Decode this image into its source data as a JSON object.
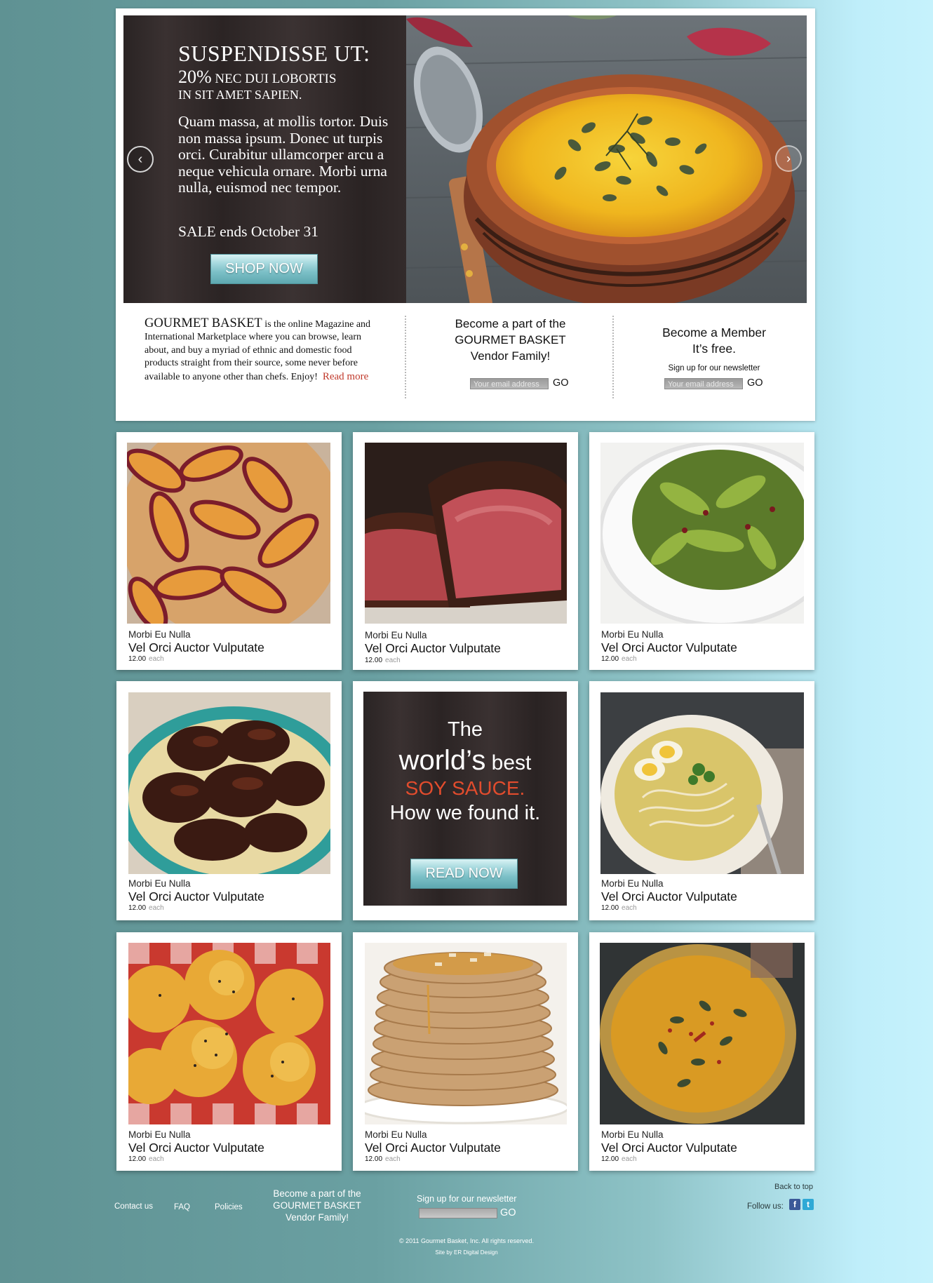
{
  "hero": {
    "title": "SUSPENDISSE UT:",
    "sub_big": "20%",
    "sub_rest": " NEC DUI LOBORTIS",
    "sub2": "IN SIT AMET SAPIEN.",
    "body": "Quam massa, at mollis tortor. Duis non massa ipsum. Donec ut turpis orci. Curabitur ullamcorper arcu a neque vehicula ornare. Morbi urna nulla, euismod nec tempor.",
    "sale": "SALE ends October 31",
    "button": "SHOP NOW",
    "arrow_left": "‹",
    "arrow_right": "›"
  },
  "info": {
    "brand": "GOURMET BASKET",
    "text": " is the online Magazine and International Marketplace where you can browse, learn about, and buy a myriad of ethnic and domestic food products straight from their source, some never before available to anyone other than chefs.  Enjoy!",
    "read_more": "Read more"
  },
  "vendor": {
    "line1": "Become a part of the",
    "line2": "GOURMET BASKET",
    "line3": "Vendor Family!",
    "placeholder": "Your email address",
    "go": "GO"
  },
  "member": {
    "line1": "Become a Member",
    "line2": "It’s free.",
    "sub": "Sign up for our newsletter",
    "placeholder": "Your email address",
    "go": "GO"
  },
  "products": [
    {
      "category": "Morbi Eu Nulla",
      "name": "Vel Orci Auctor Vulputate",
      "price": "12.00",
      "unit": "each",
      "image": "peach-tart"
    },
    {
      "category": "Morbi Eu Nulla",
      "name": "Vel Orci Auctor Vulputate",
      "price": "12.00",
      "unit": "each",
      "image": "steak"
    },
    {
      "category": "Morbi Eu Nulla",
      "name": "Vel Orci Auctor Vulputate",
      "price": "12.00",
      "unit": "each",
      "image": "green-salad"
    },
    {
      "category": "Morbi Eu Nulla",
      "name": "Vel Orci Auctor Vulputate",
      "price": "12.00",
      "unit": "each",
      "image": "glazed-chicken"
    },
    {
      "category": "Morbi Eu Nulla",
      "name": "Vel Orci Auctor Vulputate",
      "price": "12.00",
      "unit": "each",
      "image": "noodle-soup"
    },
    {
      "category": "Morbi Eu Nulla",
      "name": "Vel Orci Auctor Vulputate",
      "price": "12.00",
      "unit": "each",
      "image": "poppyseed-muffins"
    },
    {
      "category": "Morbi Eu Nulla",
      "name": "Vel Orci Auctor Vulputate",
      "price": "12.00",
      "unit": "each",
      "image": "pancakes"
    },
    {
      "category": "Morbi Eu Nulla",
      "name": "Vel Orci Auctor Vulputate",
      "price": "12.00",
      "unit": "each",
      "image": "pumpkin-soup"
    }
  ],
  "promo": {
    "line1": "The",
    "line2a": "world’s",
    "line2b": " best",
    "line3": "SOY SAUCE.",
    "line4": "How we found it.",
    "button": "READ NOW"
  },
  "footer": {
    "links": [
      "Contact us",
      "FAQ",
      "Policies"
    ],
    "vendor": [
      "Become a part of the",
      "GOURMET BASKET",
      "Vendor Family!"
    ],
    "newsletter": "Sign up for our newsletter",
    "go": "GO",
    "back_to_top": "Back to top",
    "follow": "Follow us:",
    "copyright": "© 2011 Gourmet Basket, Inc.  All rights reserved.",
    "credit": "Site by ER Digital Design"
  },
  "colors": {
    "accent_teal": "#7cc0c7",
    "promo_red": "#e24c2d",
    "read_more_red": "#c0392b"
  }
}
